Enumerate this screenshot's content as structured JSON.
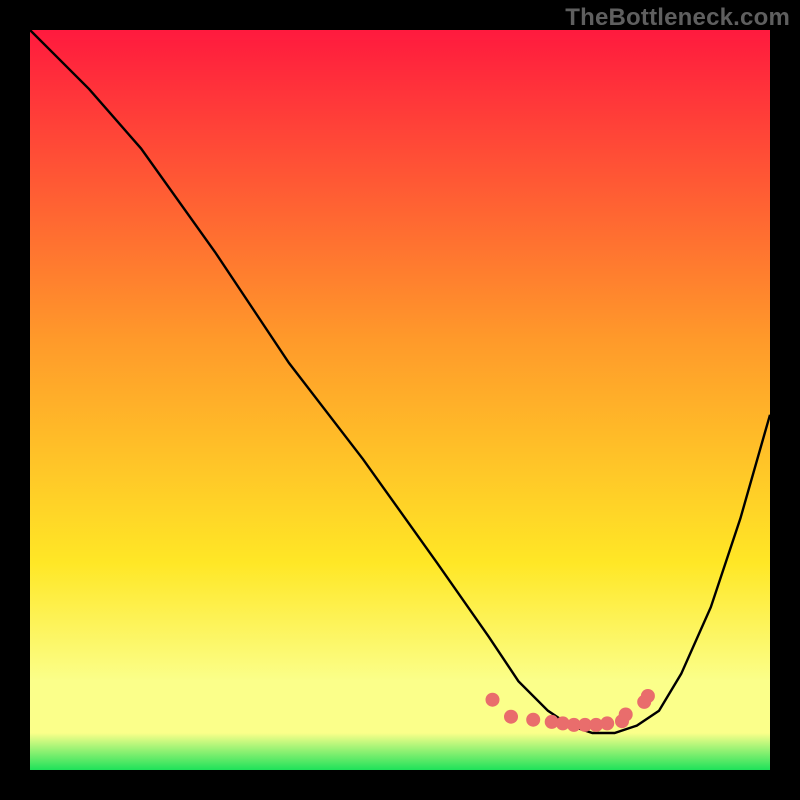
{
  "watermark": "TheBottleneck.com",
  "colors": {
    "black": "#000000",
    "gradient_top": "#ff1a3e",
    "gradient_mid1": "#ff8a2a",
    "gradient_mid2": "#ffe726",
    "gradient_band": "#fbff8a",
    "gradient_green": "#1ee25a",
    "curve": "#000000",
    "dots": "#e96d6c"
  },
  "chart_data": {
    "type": "line",
    "title": "",
    "xlabel": "",
    "ylabel": "",
    "xlim": [
      0,
      100
    ],
    "ylim": [
      0,
      100
    ],
    "series": [
      {
        "name": "bottleneck-curve",
        "x": [
          0,
          3,
          8,
          15,
          25,
          35,
          45,
          55,
          62,
          66,
          70,
          73,
          76,
          79,
          82,
          85,
          88,
          92,
          96,
          100
        ],
        "y_pct_from_top": [
          0,
          3,
          8,
          16,
          30,
          45,
          58,
          72,
          82,
          88,
          92,
          94,
          95,
          95,
          94,
          92,
          87,
          78,
          66,
          52
        ]
      }
    ],
    "optimal_dots": {
      "name": "optimal-range",
      "x": [
        62.5,
        65,
        68,
        70.5,
        72,
        73.5,
        75,
        76.5,
        78,
        80,
        80.5,
        83,
        83.5
      ],
      "y_pct_from_top": [
        90.5,
        92.8,
        93.2,
        93.5,
        93.7,
        93.9,
        93.9,
        93.9,
        93.7,
        93.4,
        92.5,
        90.8,
        90.0
      ]
    },
    "gradient_stops_pct": {
      "red": 0,
      "orange": 42,
      "yellow": 72,
      "pale_band_start": 88,
      "pale_band_end": 95,
      "green": 100
    }
  }
}
